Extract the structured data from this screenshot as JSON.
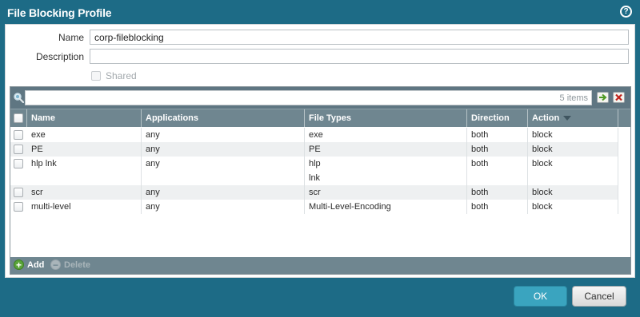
{
  "dialog": {
    "title": "File Blocking Profile",
    "help_icon_glyph": "?"
  },
  "form": {
    "name_label": "Name",
    "name_value": "corp-fileblocking",
    "description_label": "Description",
    "description_value": "",
    "shared_label": "Shared",
    "shared_checked": false
  },
  "grid": {
    "search_value": "",
    "items_count": "5 items",
    "columns": [
      "Name",
      "Applications",
      "File Types",
      "Direction",
      "Action"
    ],
    "sort_column": "Action",
    "rows": [
      {
        "name": "exe",
        "applications": "any",
        "file_types": [
          "exe"
        ],
        "direction": "both",
        "action": "block"
      },
      {
        "name": "PE",
        "applications": "any",
        "file_types": [
          "PE"
        ],
        "direction": "both",
        "action": "block"
      },
      {
        "name": "hlp lnk",
        "applications": "any",
        "file_types": [
          "hlp",
          "lnk"
        ],
        "direction": "both",
        "action": "block"
      },
      {
        "name": "scr",
        "applications": "any",
        "file_types": [
          "scr"
        ],
        "direction": "both",
        "action": "block"
      },
      {
        "name": "multi-level",
        "applications": "any",
        "file_types": [
          "Multi-Level-Encoding"
        ],
        "direction": "both",
        "action": "block"
      }
    ]
  },
  "toolbar": {
    "add_label": "Add",
    "delete_label": "Delete"
  },
  "buttons": {
    "ok_label": "OK",
    "cancel_label": "Cancel"
  },
  "colors": {
    "dialog_bg": "#1d6b86",
    "grid_header": "#6f8690",
    "ok_button": "#3aa4bf"
  },
  "icons": {
    "help": "help-icon",
    "search": "search-icon",
    "go": "arrow-right-icon",
    "clear": "close-icon",
    "add": "plus-icon",
    "delete": "minus-icon",
    "sort": "sort-down-icon"
  }
}
